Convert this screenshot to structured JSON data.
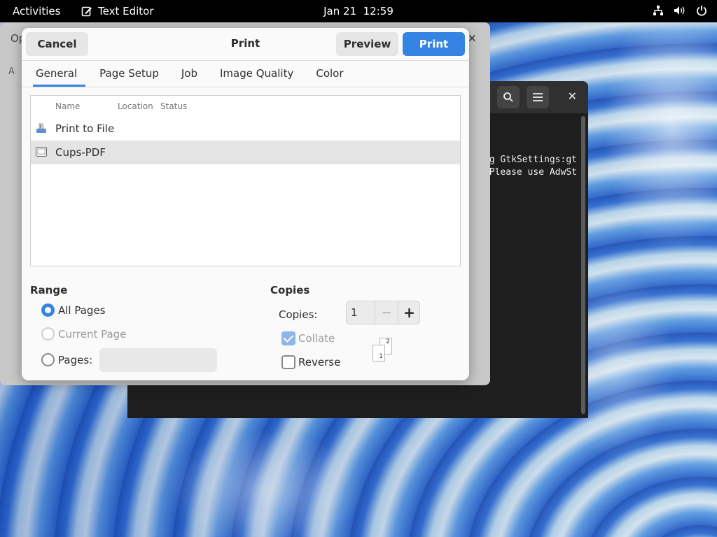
{
  "topbar": {
    "activities": "Activities",
    "app_name": "Text Editor",
    "app_icon": "text-editor-icon",
    "clock_date": "Jan 21",
    "clock_time": "12:59",
    "tray_icons": [
      "network-icon",
      "volume-icon",
      "power-icon"
    ]
  },
  "editor_window": {
    "title": "Op"
  },
  "terminal_window": {
    "lines": [
      "g GtkSettings:gt",
      "Please use AdwSt"
    ]
  },
  "print_dialog": {
    "title": "Print",
    "cancel_label": "Cancel",
    "preview_label": "Preview",
    "print_label": "Print",
    "tabs": [
      {
        "label": "General",
        "active": true
      },
      {
        "label": "Page Setup",
        "active": false
      },
      {
        "label": "Job",
        "active": false
      },
      {
        "label": "Image Quality",
        "active": false
      },
      {
        "label": "Color",
        "active": false
      }
    ],
    "printer_columns": [
      "Name",
      "Location",
      "Status"
    ],
    "printers": [
      {
        "name": "Print to File",
        "icon": "print-to-file-icon",
        "selected": false
      },
      {
        "name": "Cups-PDF",
        "icon": "printer-icon",
        "selected": true
      }
    ],
    "range": {
      "title": "Range",
      "all_pages": "All Pages",
      "current_page": "Current Page",
      "pages": "Pages:",
      "pages_value": "",
      "selected": "All Pages"
    },
    "copies": {
      "title": "Copies",
      "label": "Copies:",
      "value": "1",
      "collate_label": "Collate",
      "collate_checked": true,
      "reverse_label": "Reverse",
      "reverse_checked": false,
      "collate_sheet_front": "1",
      "collate_sheet_back": "2"
    },
    "accent_color": "#3584e4"
  }
}
